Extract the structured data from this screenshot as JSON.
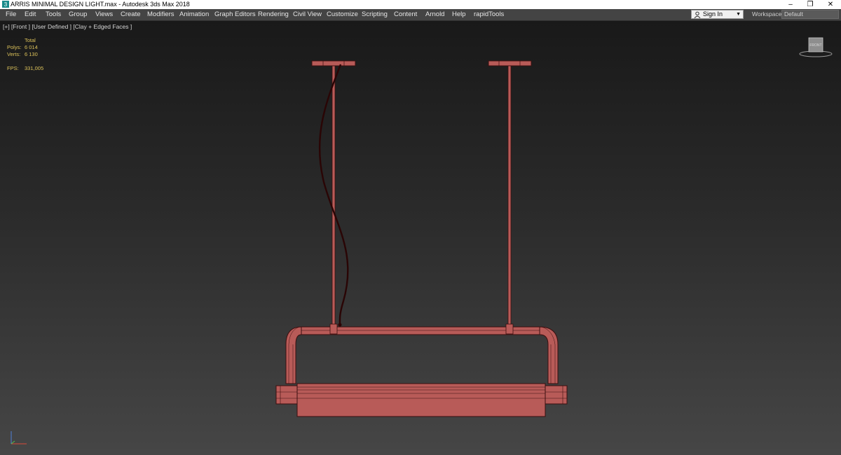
{
  "titlebar": {
    "title": "ARRIS MINIMAL DESIGN LIGHT.max - Autodesk 3ds Max 2018",
    "app_icon": "3ds-max-icon",
    "minimize": "–",
    "restore": "❐",
    "close": "✕"
  },
  "menubar": {
    "items": [
      "File",
      "Edit",
      "Tools",
      "Group",
      "Views",
      "Create",
      "Modifiers",
      "Animation",
      "Graph Editors",
      "Rendering",
      "Civil View",
      "Customize",
      "Scripting",
      "Content",
      "Arnold",
      "Help",
      "rapidTools"
    ]
  },
  "account": {
    "signin_label": "Sign In",
    "icon": "user-icon"
  },
  "workspaces": {
    "label": "Workspaces:",
    "selected": "Default"
  },
  "viewport": {
    "label": "[+] [Front ] [User Defined ] [Clay + Edged Faces ]",
    "stats": {
      "header": "Total",
      "polys_label": "Polys:",
      "polys_value": "6 014",
      "verts_label": "Verts:",
      "verts_value": "6 130",
      "fps_label": "FPS:",
      "fps_value": "331,005"
    },
    "viewcube_icon": "viewcube-icon",
    "colors": {
      "model": "#b85b58",
      "model_edge": "#3a0f0f",
      "cable": "#2a0505",
      "stats": "#dcc25a"
    }
  }
}
